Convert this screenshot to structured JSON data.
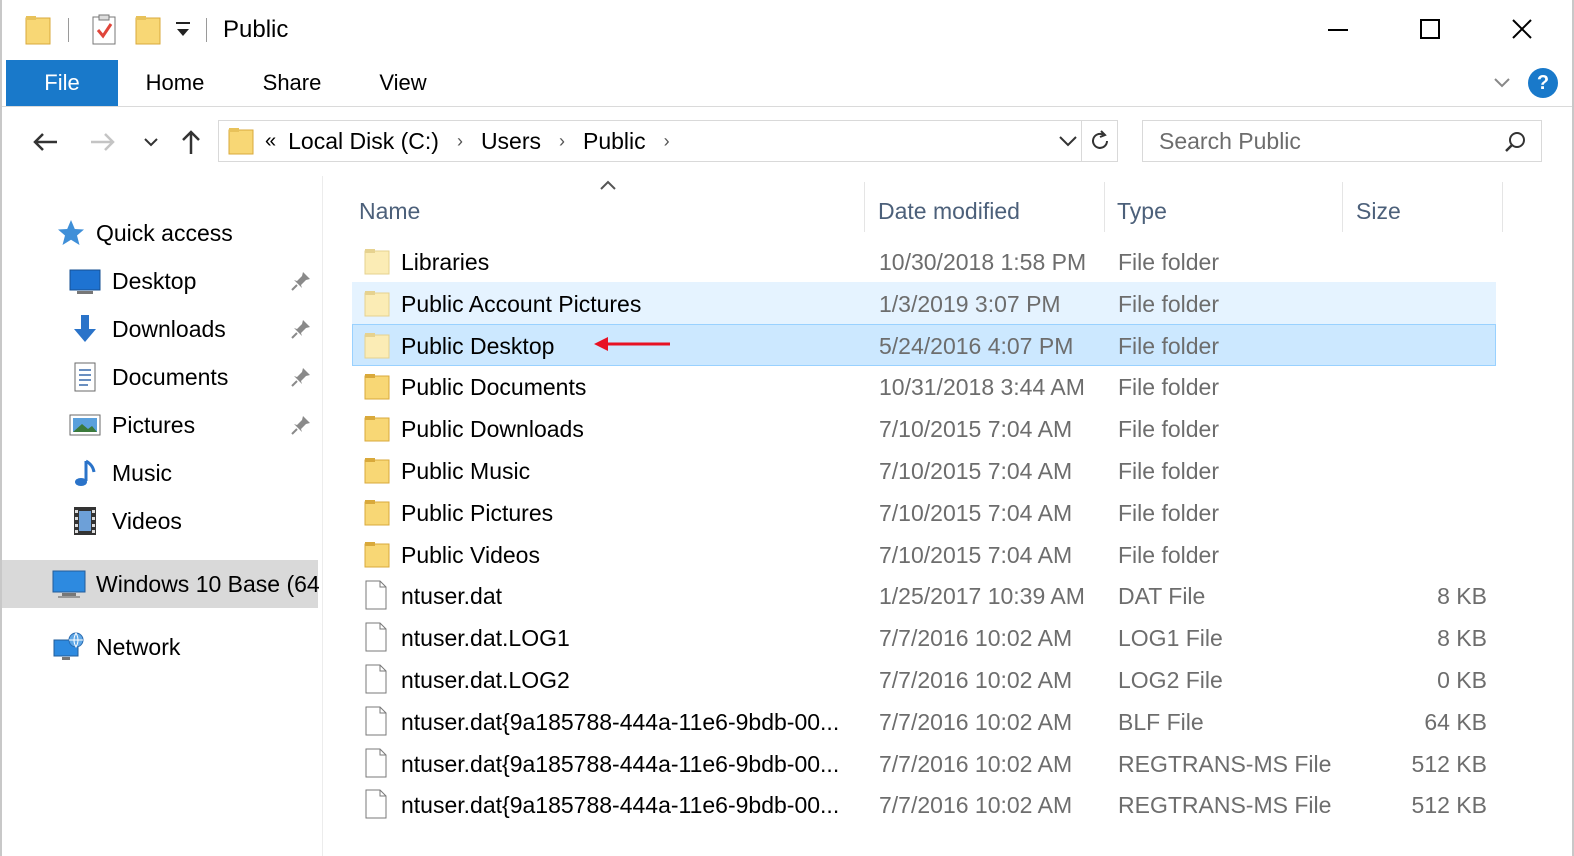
{
  "window": {
    "title": "Public",
    "minimize_icon": "minimize-icon",
    "maximize_icon": "maximize-icon",
    "close_icon": "close-icon"
  },
  "ribbon": {
    "tabs": [
      "File",
      "Home",
      "Share",
      "View"
    ],
    "help_label": "?"
  },
  "navbar": {
    "breadcrumb_overflow": "«",
    "breadcrumb": [
      "Local Disk (C:)",
      "Users",
      "Public"
    ],
    "search_placeholder": "Search Public"
  },
  "sidebar": {
    "quick_access": "Quick access",
    "items": [
      {
        "label": "Desktop",
        "icon": "desktop-icon",
        "pinned": true
      },
      {
        "label": "Downloads",
        "icon": "downloads-icon",
        "pinned": true
      },
      {
        "label": "Documents",
        "icon": "documents-icon",
        "pinned": true
      },
      {
        "label": "Pictures",
        "icon": "pictures-icon",
        "pinned": true
      },
      {
        "label": "Music",
        "icon": "music-icon",
        "pinned": false
      },
      {
        "label": "Videos",
        "icon": "videos-icon",
        "pinned": false
      }
    ],
    "this_pc": "Windows 10 Base (64",
    "network": "Network"
  },
  "columns": {
    "name": "Name",
    "date": "Date modified",
    "type": "Type",
    "size": "Size"
  },
  "files": [
    {
      "name": "Libraries",
      "date": "10/30/2018 1:58 PM",
      "type": "File folder",
      "size": "",
      "kind": "folder-faded",
      "state": ""
    },
    {
      "name": "Public Account Pictures",
      "date": "1/3/2019 3:07 PM",
      "type": "File folder",
      "size": "",
      "kind": "folder-faded",
      "state": "hover"
    },
    {
      "name": "Public Desktop",
      "date": "5/24/2016 4:07 PM",
      "type": "File folder",
      "size": "",
      "kind": "folder-faded",
      "state": "selected"
    },
    {
      "name": "Public Documents",
      "date": "10/31/2018 3:44 AM",
      "type": "File folder",
      "size": "",
      "kind": "folder",
      "state": ""
    },
    {
      "name": "Public Downloads",
      "date": "7/10/2015 7:04 AM",
      "type": "File folder",
      "size": "",
      "kind": "folder",
      "state": ""
    },
    {
      "name": "Public Music",
      "date": "7/10/2015 7:04 AM",
      "type": "File folder",
      "size": "",
      "kind": "folder",
      "state": ""
    },
    {
      "name": "Public Pictures",
      "date": "7/10/2015 7:04 AM",
      "type": "File folder",
      "size": "",
      "kind": "folder",
      "state": ""
    },
    {
      "name": "Public Videos",
      "date": "7/10/2015 7:04 AM",
      "type": "File folder",
      "size": "",
      "kind": "folder",
      "state": ""
    },
    {
      "name": "ntuser.dat",
      "date": "1/25/2017 10:39 AM",
      "type": "DAT File",
      "size": "8 KB",
      "kind": "file",
      "state": ""
    },
    {
      "name": "ntuser.dat.LOG1",
      "date": "7/7/2016 10:02 AM",
      "type": "LOG1 File",
      "size": "8 KB",
      "kind": "file",
      "state": ""
    },
    {
      "name": "ntuser.dat.LOG2",
      "date": "7/7/2016 10:02 AM",
      "type": "LOG2 File",
      "size": "0 KB",
      "kind": "file",
      "state": ""
    },
    {
      "name": "ntuser.dat{9a185788-444a-11e6-9bdb-00...",
      "date": "7/7/2016 10:02 AM",
      "type": "BLF File",
      "size": "64 KB",
      "kind": "file",
      "state": ""
    },
    {
      "name": "ntuser.dat{9a185788-444a-11e6-9bdb-00...",
      "date": "7/7/2016 10:02 AM",
      "type": "REGTRANS-MS File",
      "size": "512 KB",
      "kind": "file",
      "state": ""
    },
    {
      "name": "ntuser.dat{9a185788-444a-11e6-9bdb-00...",
      "date": "7/7/2016 10:02 AM",
      "type": "REGTRANS-MS File",
      "size": "512 KB",
      "kind": "file",
      "state": ""
    }
  ],
  "annotation": {
    "icon": "red-arrow-icon",
    "color": "#e81123"
  },
  "colors": {
    "accent": "#1979ca",
    "selected_bg": "#cce8ff",
    "selected_border": "#99d1ff",
    "hover_bg": "#e5f3ff",
    "folder": "#f8d775",
    "folder_faded": "#fbecb5"
  }
}
